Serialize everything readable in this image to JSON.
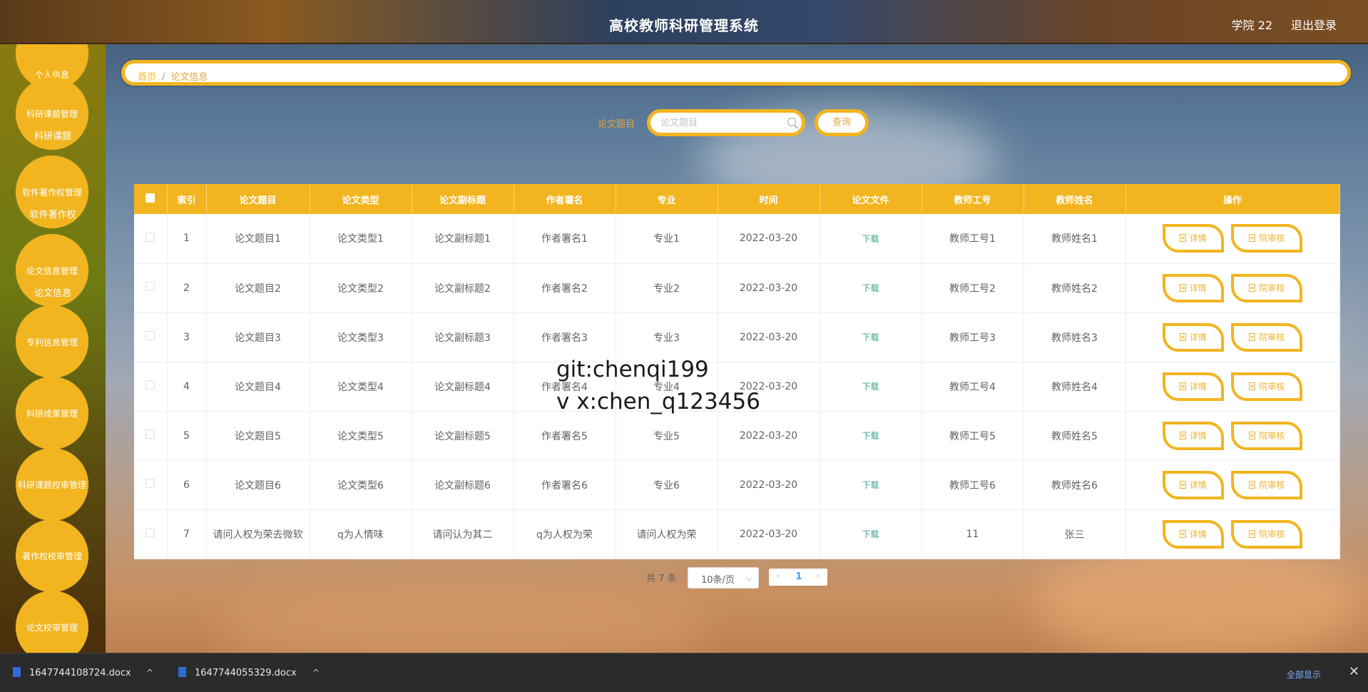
{
  "header": {
    "title": "高校教师科研管理系统",
    "user": "学院 22",
    "logout": "退出登录"
  },
  "sidebar": {
    "items": [
      {
        "label": "个人信息",
        "sub": ""
      },
      {
        "label": "科研课题管理",
        "sub": "科研课题"
      },
      {
        "label": "软件著作权管理",
        "sub": "软件著作权"
      },
      {
        "label": "论文信息管理",
        "sub": "论文信息"
      },
      {
        "label": "专利信息管理",
        "sub": ""
      },
      {
        "label": "科研成果管理",
        "sub": ""
      },
      {
        "label": "科研课题校审管理",
        "sub": ""
      },
      {
        "label": "著作权校审管理",
        "sub": ""
      },
      {
        "label": "论文校审管理",
        "sub": ""
      }
    ]
  },
  "breadcrumb": {
    "home": "首页",
    "separator": "/",
    "current": "论文信息"
  },
  "search": {
    "label": "论文题目",
    "placeholder": "论文题目",
    "value": "",
    "button": "查询"
  },
  "table": {
    "headers": [
      "索引",
      "论文题目",
      "论文类型",
      "论文副标题",
      "作者署名",
      "专业",
      "时间",
      "论文文件",
      "教师工号",
      "教师姓名",
      "操作"
    ],
    "download_label": "下载",
    "detail_label": "详情",
    "review_label": "院审核",
    "rows": [
      [
        "1",
        "论文题目1",
        "论文类型1",
        "论文副标题1",
        "作者署名1",
        "专业1",
        "2022-03-20",
        "教师工号1",
        "教师姓名1"
      ],
      [
        "2",
        "论文题目2",
        "论文类型2",
        "论文副标题2",
        "作者署名2",
        "专业2",
        "2022-03-20",
        "教师工号2",
        "教师姓名2"
      ],
      [
        "3",
        "论文题目3",
        "论文类型3",
        "论文副标题3",
        "作者署名3",
        "专业3",
        "2022-03-20",
        "教师工号3",
        "教师姓名3"
      ],
      [
        "4",
        "论文题目4",
        "论文类型4",
        "论文副标题4",
        "作者署名4",
        "专业4",
        "2022-03-20",
        "教师工号4",
        "教师姓名4"
      ],
      [
        "5",
        "论文题目5",
        "论文类型5",
        "论文副标题5",
        "作者署名5",
        "专业5",
        "2022-03-20",
        "教师工号5",
        "教师姓名5"
      ],
      [
        "6",
        "论文题目6",
        "论文类型6",
        "论文副标题6",
        "作者署名6",
        "专业6",
        "2022-03-20",
        "教师工号6",
        "教师姓名6"
      ],
      [
        "7",
        "请问人权为荣去微软",
        "q为人情味",
        "请问认为其二",
        "q为人权为荣",
        "请问人权为荣",
        "2022-03-20",
        "11",
        "张三"
      ]
    ]
  },
  "pagination": {
    "total": "共 7 条",
    "page_size": "10条/页",
    "current_page": "1",
    "prev": "‹",
    "next": "›"
  },
  "watermark": {
    "line1": "git:chenqi199",
    "line2": "v x:chen_q123456"
  },
  "downloads": {
    "files": [
      "1647744108724.docx",
      "1647744055329.docx"
    ],
    "show_all": "全部显示",
    "close": "✕",
    "caret": "^"
  },
  "colors": {
    "accent": "#f2b51f",
    "download_link": "#3aa38b",
    "page_active": "#409eff"
  }
}
